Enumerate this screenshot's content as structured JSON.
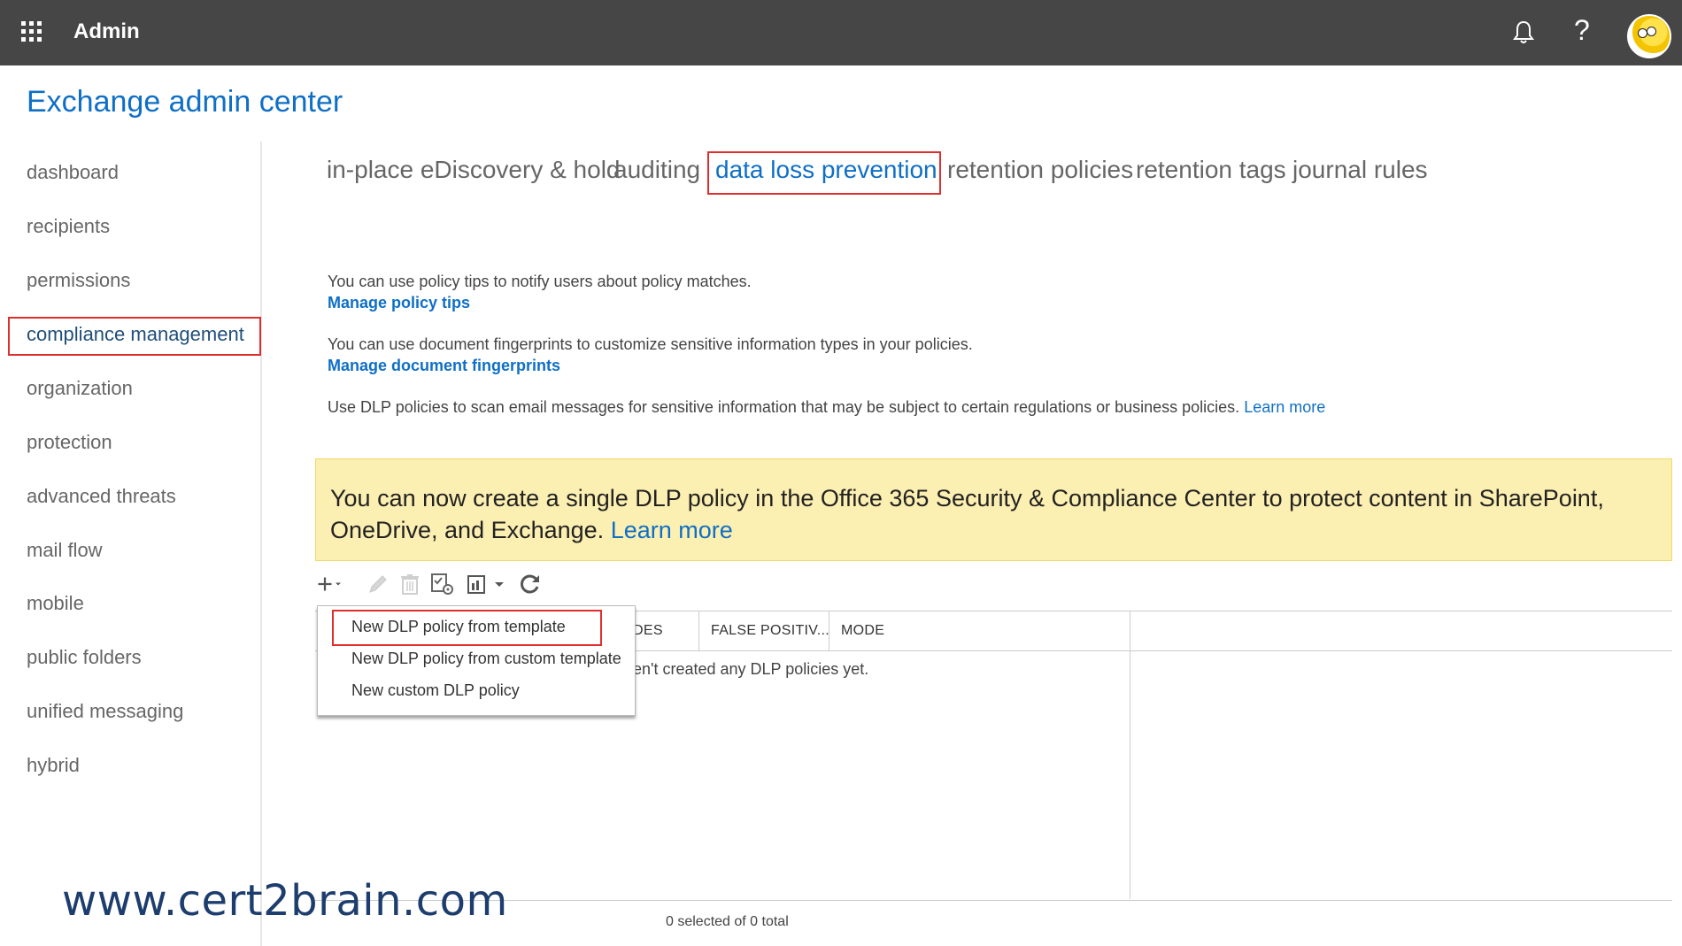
{
  "topbar": {
    "app_title": "Admin",
    "icons": [
      "app-launcher-icon",
      "bell-icon",
      "help-icon",
      "user-avatar"
    ],
    "help_glyph": "?"
  },
  "page": {
    "title": "Exchange admin center"
  },
  "sidebar": {
    "items": [
      {
        "label": "dashboard"
      },
      {
        "label": "recipients"
      },
      {
        "label": "permissions"
      },
      {
        "label": "compliance management"
      },
      {
        "label": "organization"
      },
      {
        "label": "protection"
      },
      {
        "label": "advanced threats"
      },
      {
        "label": "mail flow"
      },
      {
        "label": "mobile"
      },
      {
        "label": "public folders"
      },
      {
        "label": "unified messaging"
      },
      {
        "label": "hybrid"
      }
    ],
    "active": "compliance management"
  },
  "tabs": {
    "items": [
      {
        "label": "in-place eDiscovery & hold"
      },
      {
        "label": "auditing"
      },
      {
        "label": "data loss prevention"
      },
      {
        "label": "retention policies"
      },
      {
        "label": "retention tags"
      },
      {
        "label": "journal rules"
      }
    ],
    "active": "data loss prevention"
  },
  "content": {
    "policy_tips_text": "You can use policy tips to notify users about policy matches.",
    "policy_tips_link": "Manage policy tips",
    "fingerprints_text": "You can use document fingerprints to customize sensitive information types in your policies.",
    "fingerprints_link": "Manage document fingerprints",
    "dlp_text": "Use DLP policies to scan email messages for sensitive information that may be subject to certain regulations or business policies.",
    "dlp_learn_more": "Learn more"
  },
  "banner": {
    "text": "You can now create a single DLP policy in the Office 365 Security & Compliance Center to protect content in SharePoint, OneDrive, and Exchange.",
    "link": "Learn more",
    "color": "#fcefb2"
  },
  "toolbar": {
    "icons": [
      "add-icon",
      "edit-icon",
      "delete-icon",
      "manage-icon",
      "export-icon",
      "refresh-icon"
    ]
  },
  "table": {
    "columns": [
      "DES",
      "FALSE POSITIV...",
      "MODE"
    ],
    "empty_message": "en't created any DLP policies yet.",
    "status": "0 selected of 0 total"
  },
  "dropdown_menu": {
    "items": [
      {
        "label": "New DLP policy from template"
      },
      {
        "label": "New DLP policy from custom template"
      },
      {
        "label": "New custom DLP policy"
      }
    ],
    "highlighted": "New DLP policy from template"
  },
  "watermark": {
    "text": "www.cert2brain.com"
  },
  "colors": {
    "accent": "#0f6fc6",
    "topbar": "#464646",
    "highlight_box": "#e02e2e"
  }
}
